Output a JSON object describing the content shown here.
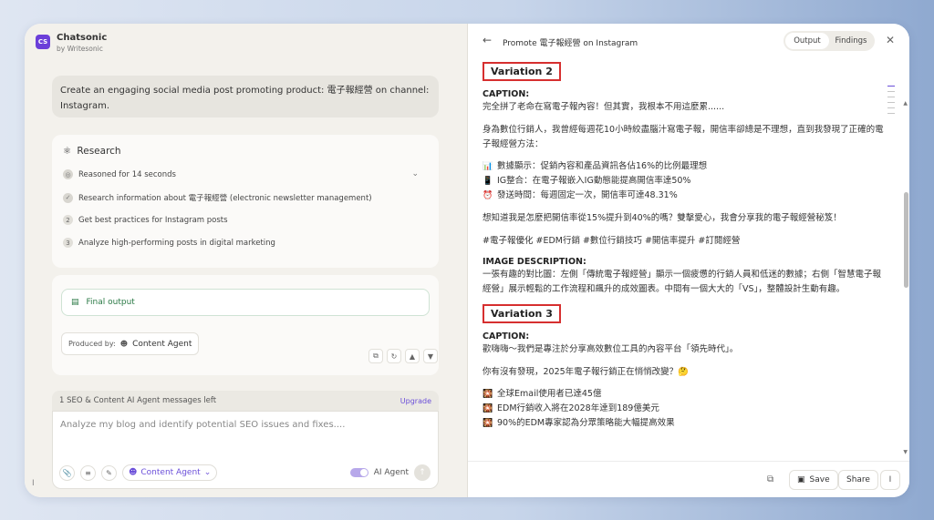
{
  "brand": {
    "logo": "CS",
    "name": "Chatsonic",
    "sub": "by Writesonic"
  },
  "prompt": "Create an engaging social media post promoting product: 電子報經營 on channel: Instagram.",
  "research": {
    "title": "Research",
    "steps": [
      {
        "marker": "",
        "icon": "bulb-icon",
        "label": "Reasoned for 14 seconds"
      },
      {
        "marker": "",
        "icon": "check-icon",
        "label": "Research information about 電子報經營 (electronic newsletter management)"
      },
      {
        "marker": "2",
        "icon": "",
        "label": "Get best practices for Instagram posts"
      },
      {
        "marker": "3",
        "icon": "",
        "label": "Analyze high-performing posts in digital marketing"
      }
    ]
  },
  "final_output": {
    "label": "Final output",
    "produced_by_label": "Produced by:",
    "agent": "Content Agent"
  },
  "limit": {
    "text": "1 SEO & Content AI Agent messages left",
    "upgrade": "Upgrade"
  },
  "composer": {
    "placeholder": "Analyze my blog and identify potential SEO issues and fixes....",
    "agent": "Content Agent",
    "ai_agent_label": "AI Agent",
    "ai_agent_on": true
  },
  "right": {
    "title": "Promote 電子報經營 on Instagram",
    "tabs": [
      "Output",
      "Findings"
    ],
    "active_tab": "Output",
    "variation2": {
      "heading": "Variation 2",
      "caption_label": "CAPTION:",
      "caption_lines": [
        "完全拼了老命在寫電子報內容！但其實，我根本不用這麼累......",
        "身為數位行銷人，我曾經每週花10小時絞盡腦汁寫電子報，開信率卻總是不理想，直到我發現了正確的電子報經營方法："
      ],
      "bullets": [
        {
          "icon": "📊",
          "text": "數據顯示：促銷內容和產品資訊各佔16%的比例最理想"
        },
        {
          "icon": "📱",
          "text": "IG整合：在電子報嵌入IG動態能提高開信率達50%"
        },
        {
          "icon": "⏰",
          "text": "發送時間：每週固定一次，開信率可達48.31%"
        }
      ],
      "cta": "想知道我是怎麼把開信率從15%提升到40%的嗎？雙擊愛心，我會分享我的電子報經營秘笈！",
      "hashtags": "#電子報優化 #EDM行銷 #數位行銷技巧 #開信率提升 #訂閱經營",
      "image_label": "IMAGE DESCRIPTION:",
      "image_desc": "一張有趣的對比圖：左側「傳統電子報經營」顯示一個疲憊的行銷人員和低迷的數據；右側「智慧電子報經營」展示輕鬆的工作流程和飆升的成效圖表。中間有一個大大的「VS」，整體設計生動有趣。"
    },
    "variation3": {
      "heading": "Variation 3",
      "caption_label": "CAPTION:",
      "line1": "歡嗨嗨～我們是專注於分享高效數位工具的內容平台「領先時代」。",
      "line2": "你有沒有發現，2025年電子報行銷正在悄悄改變？🤔",
      "bullets": [
        {
          "icon": "🎇",
          "text": "全球Email使用者已達45億"
        },
        {
          "icon": "🎇",
          "text": "EDM行銷收入將在2028年達到189億美元"
        },
        {
          "icon": "🎇",
          "text": "90%的EDM專家認為分眾策略能大幅提高效果"
        }
      ]
    },
    "footer": {
      "save": "Save",
      "share": "Share"
    }
  }
}
